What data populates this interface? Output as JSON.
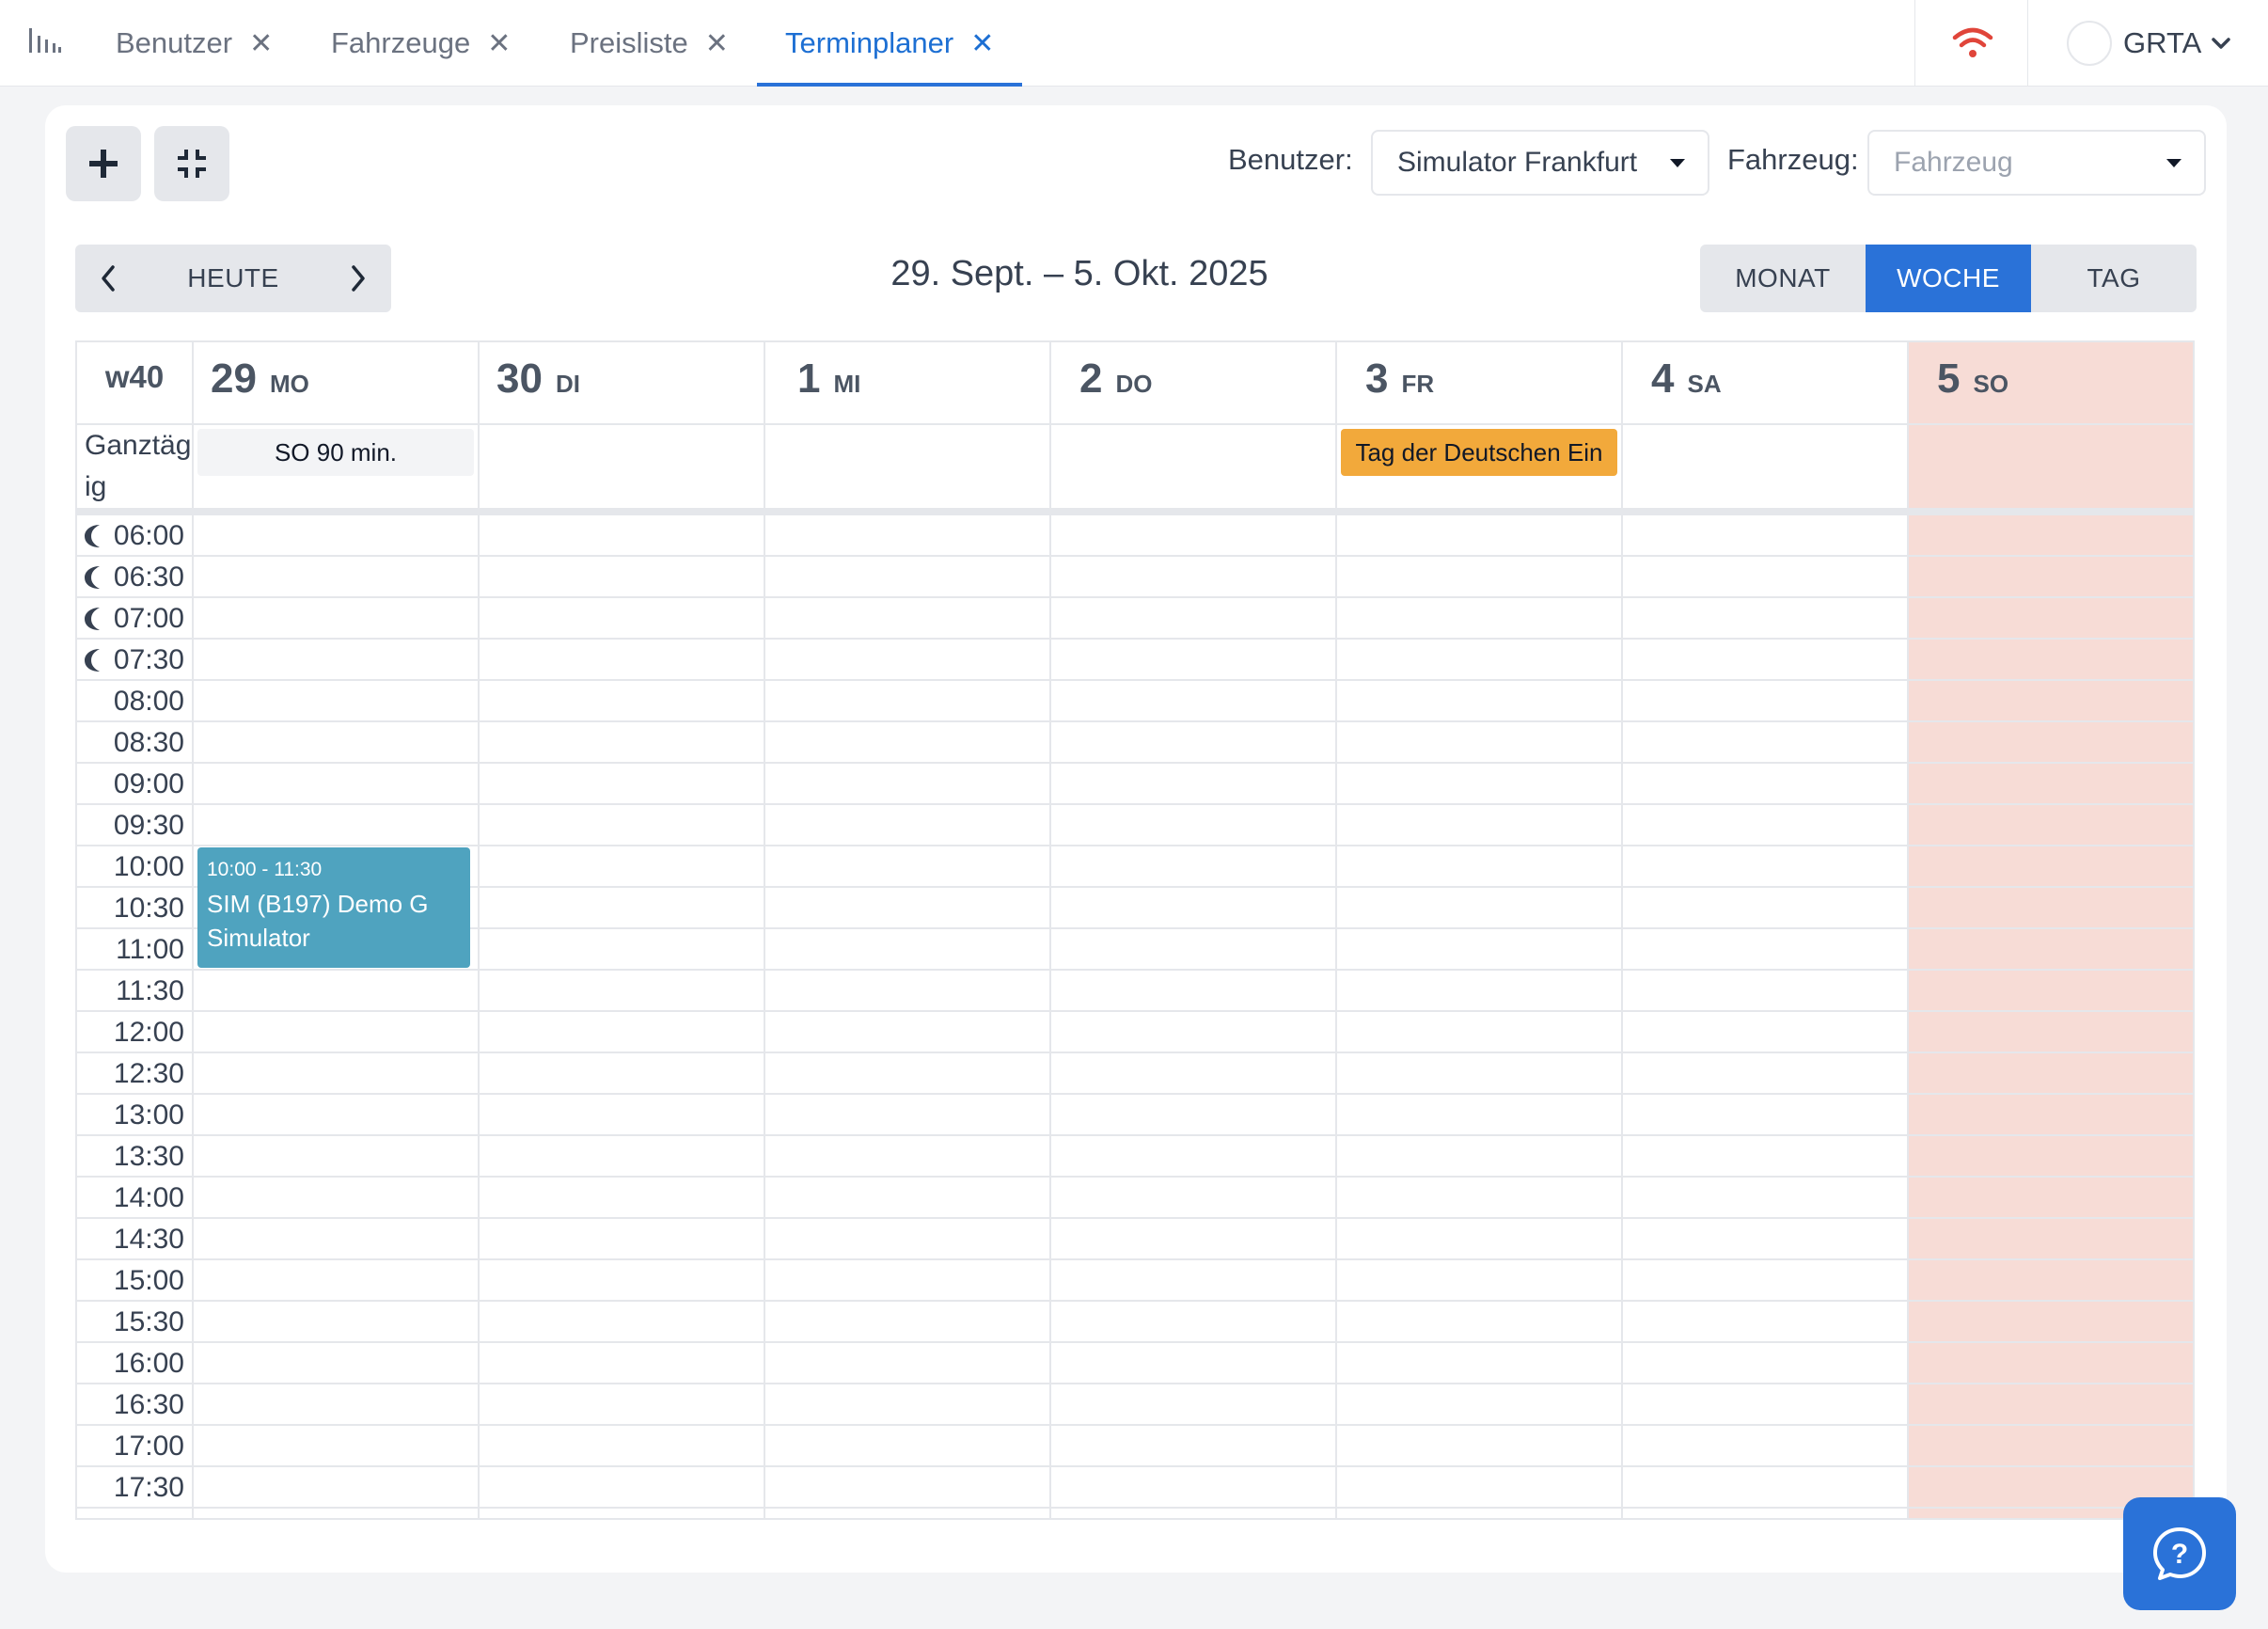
{
  "tabs": [
    {
      "label": "Benutzer"
    },
    {
      "label": "Fahrzeuge"
    },
    {
      "label": "Preisliste"
    },
    {
      "label": "Terminplaner"
    }
  ],
  "active_tab": "Terminplaner",
  "user": {
    "name": "GRTA"
  },
  "filters": {
    "user_label": "Benutzer:",
    "user_value": "Simulator Frankfurt",
    "vehicle_label": "Fahrzeug:",
    "vehicle_placeholder": "Fahrzeug"
  },
  "nav": {
    "today_label": "HEUTE"
  },
  "range_title": "29. Sept. – 5. Okt. 2025",
  "views": [
    {
      "label": "MONAT"
    },
    {
      "label": "WOCHE"
    },
    {
      "label": "TAG"
    }
  ],
  "active_view": "WOCHE",
  "calendar": {
    "week_label": "w40",
    "days": [
      {
        "num": "29",
        "abbr": "MO"
      },
      {
        "num": "30",
        "abbr": "DI"
      },
      {
        "num": "1",
        "abbr": "MI"
      },
      {
        "num": "2",
        "abbr": "DO"
      },
      {
        "num": "3",
        "abbr": "FR"
      },
      {
        "num": "4",
        "abbr": "SA"
      },
      {
        "num": "5",
        "abbr": "SO"
      }
    ],
    "allday_label": "Ganztägig",
    "allday_events": [
      {
        "text": "SO 90 min.",
        "day": "MO"
      },
      {
        "text": "Tag der Deutschen Ein",
        "day": "FR"
      }
    ],
    "times": [
      "06:00",
      "06:30",
      "07:00",
      "07:30",
      "08:00",
      "08:30",
      "09:00",
      "09:30",
      "10:00",
      "10:30",
      "11:00",
      "11:30",
      "12:00",
      "12:30",
      "13:00",
      "13:30",
      "14:00",
      "14:30",
      "15:00",
      "15:30",
      "16:00",
      "16:30",
      "17:00",
      "17:30"
    ],
    "night_times": [
      "06:00",
      "06:30",
      "07:00",
      "07:30"
    ],
    "events": [
      {
        "time": "10:00 - 11:30",
        "title": "SIM (B197) Demo G Simulator",
        "day": "MO",
        "color": "#4fa3bf"
      }
    ]
  },
  "colors": {
    "accent": "#2a72d8",
    "sunday_bg": "#f7dcd6",
    "holiday": "#f2a93b",
    "event": "#4fa3bf",
    "wifi": "#e0453a"
  },
  "icons": {
    "app": "bar-chart-icon",
    "close": "close-icon",
    "wifi": "wifi-icon",
    "add": "plus-icon",
    "collapse": "compress-icon",
    "prev": "chevron-left-icon",
    "next": "chevron-right-icon",
    "night": "moon-icon",
    "help": "help-icon"
  }
}
